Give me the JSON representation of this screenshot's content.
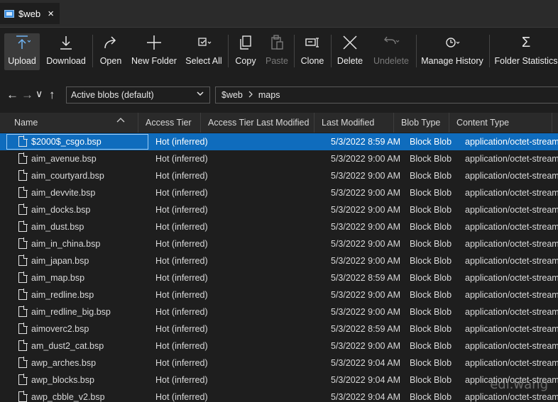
{
  "tab": {
    "title": "$web",
    "close": "×"
  },
  "toolbar": {
    "upload": "Upload",
    "download": "Download",
    "open": "Open",
    "new_folder": "New Folder",
    "select_all": "Select All",
    "copy": "Copy",
    "paste": "Paste",
    "clone": "Clone",
    "delete": "Delete",
    "undelete": "Undelete",
    "manage_history": "Manage History",
    "folder_statistics": "Folder Statistics"
  },
  "nav": {
    "back": "←",
    "forward": "→",
    "expand": "∨",
    "up": "↑",
    "view_select": "Active blobs (default)",
    "path": [
      "$web",
      "maps"
    ]
  },
  "columns": [
    "Name",
    "Access Tier",
    "Access Tier Last Modified",
    "Last Modified",
    "Blob Type",
    "Content Type"
  ],
  "rows": [
    {
      "name": "$2000$_csgo.bsp",
      "tier": "Hot (inferred)",
      "modified": "5/3/2022 8:59 AM",
      "type": "Block Blob",
      "content": "application/octet-stream"
    },
    {
      "name": "aim_avenue.bsp",
      "tier": "Hot (inferred)",
      "modified": "5/3/2022 9:00 AM",
      "type": "Block Blob",
      "content": "application/octet-stream"
    },
    {
      "name": "aim_courtyard.bsp",
      "tier": "Hot (inferred)",
      "modified": "5/3/2022 9:00 AM",
      "type": "Block Blob",
      "content": "application/octet-stream"
    },
    {
      "name": "aim_devvite.bsp",
      "tier": "Hot (inferred)",
      "modified": "5/3/2022 9:00 AM",
      "type": "Block Blob",
      "content": "application/octet-stream"
    },
    {
      "name": "aim_docks.bsp",
      "tier": "Hot (inferred)",
      "modified": "5/3/2022 9:00 AM",
      "type": "Block Blob",
      "content": "application/octet-stream"
    },
    {
      "name": "aim_dust.bsp",
      "tier": "Hot (inferred)",
      "modified": "5/3/2022 9:00 AM",
      "type": "Block Blob",
      "content": "application/octet-stream"
    },
    {
      "name": "aim_in_china.bsp",
      "tier": "Hot (inferred)",
      "modified": "5/3/2022 9:00 AM",
      "type": "Block Blob",
      "content": "application/octet-stream"
    },
    {
      "name": "aim_japan.bsp",
      "tier": "Hot (inferred)",
      "modified": "5/3/2022 9:00 AM",
      "type": "Block Blob",
      "content": "application/octet-stream"
    },
    {
      "name": "aim_map.bsp",
      "tier": "Hot (inferred)",
      "modified": "5/3/2022 8:59 AM",
      "type": "Block Blob",
      "content": "application/octet-stream"
    },
    {
      "name": "aim_redline.bsp",
      "tier": "Hot (inferred)",
      "modified": "5/3/2022 9:00 AM",
      "type": "Block Blob",
      "content": "application/octet-stream"
    },
    {
      "name": "aim_redline_big.bsp",
      "tier": "Hot (inferred)",
      "modified": "5/3/2022 9:00 AM",
      "type": "Block Blob",
      "content": "application/octet-stream"
    },
    {
      "name": "aimoverc2.bsp",
      "tier": "Hot (inferred)",
      "modified": "5/3/2022 8:59 AM",
      "type": "Block Blob",
      "content": "application/octet-stream"
    },
    {
      "name": "am_dust2_cat.bsp",
      "tier": "Hot (inferred)",
      "modified": "5/3/2022 9:00 AM",
      "type": "Block Blob",
      "content": "application/octet-stream"
    },
    {
      "name": "awp_arches.bsp",
      "tier": "Hot (inferred)",
      "modified": "5/3/2022 9:04 AM",
      "type": "Block Blob",
      "content": "application/octet-stream"
    },
    {
      "name": "awp_blocks.bsp",
      "tier": "Hot (inferred)",
      "modified": "5/3/2022 9:04 AM",
      "type": "Block Blob",
      "content": "application/octet-stream"
    },
    {
      "name": "awp_cbble_v2.bsp",
      "tier": "Hot (inferred)",
      "modified": "5/3/2022 9:04 AM",
      "type": "Block Blob",
      "content": "application/octet-stream"
    }
  ],
  "watermark": "edi.wang",
  "colors": {
    "selection": "#0f6cbd",
    "background": "#1e1e1e"
  }
}
